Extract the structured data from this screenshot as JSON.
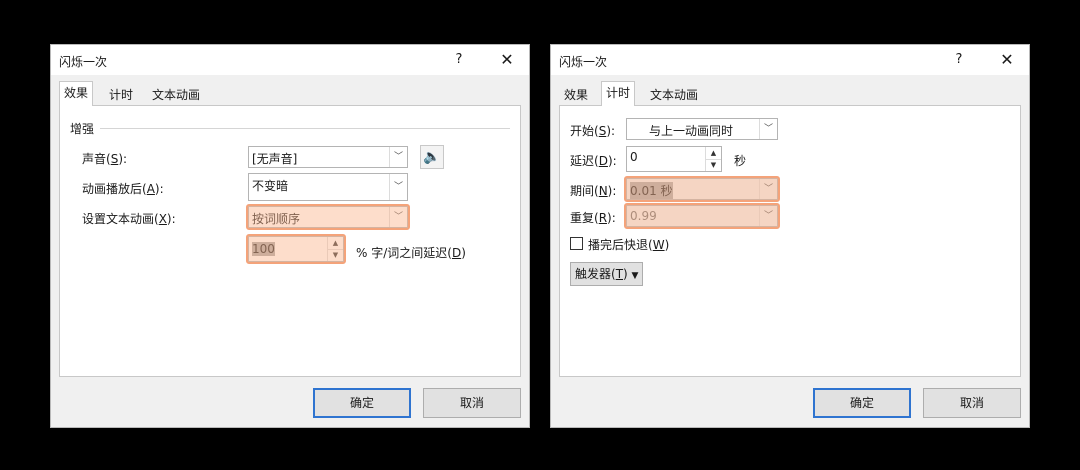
{
  "left": {
    "title": "闪烁一次",
    "help": "?",
    "close": "✕",
    "tabs": [
      "效果",
      "计时",
      "文本动画"
    ],
    "group": "增强",
    "sound": {
      "label": "声音(S):",
      "value": "[无声音]"
    },
    "after": {
      "label": "动画播放后(A):",
      "value": "不变暗"
    },
    "animate_text": {
      "label": "设置文本动画(X):",
      "value": "按词顺序"
    },
    "delay": {
      "value": "100",
      "suffix": "% 字/词之间延迟(D)"
    },
    "ok": "确定",
    "cancel": "取消"
  },
  "right": {
    "title": "闪烁一次",
    "help": "?",
    "close": "✕",
    "tabs": [
      "效果",
      "计时",
      "文本动画"
    ],
    "start": {
      "label": "开始(S):",
      "value": "与上一动画同时"
    },
    "delay": {
      "label": "延迟(D):",
      "value": "0",
      "unit": "秒"
    },
    "duration": {
      "label": "期间(N):",
      "value": "0.01 秒"
    },
    "repeat": {
      "label": "重复(R):",
      "value": "0.99"
    },
    "rewind": {
      "label": "播完后快退(W)"
    },
    "triggers": {
      "label": "触发器(T)",
      "icon": "▼"
    },
    "ok": "确定",
    "cancel": "取消"
  },
  "colors": {
    "highlight": "#f4a37a",
    "default_button_border": "#2f74d0"
  }
}
